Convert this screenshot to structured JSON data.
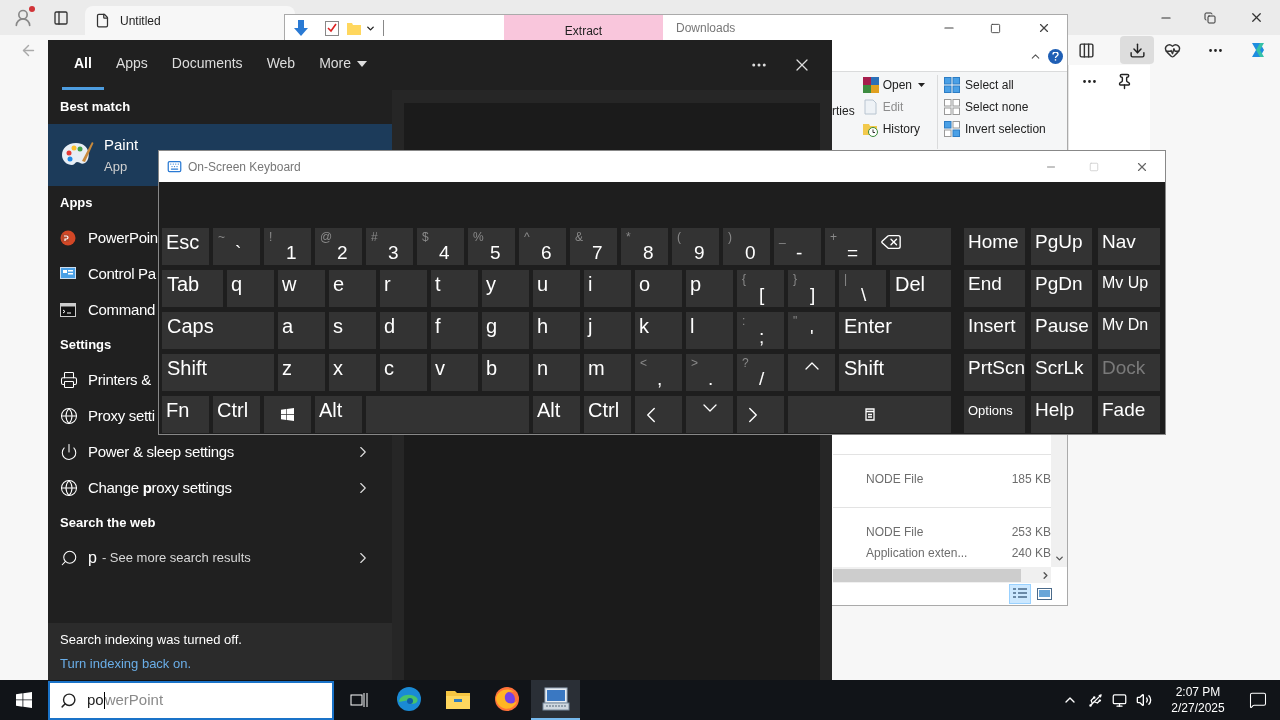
{
  "browser": {
    "tab": {
      "title": "Untitled"
    }
  },
  "explorer": {
    "ribbon_tab": "Extract",
    "title": "Downloads",
    "fragment": "rties",
    "open_group": [
      {
        "label": "Open",
        "kind": "dropdown",
        "disabled": false
      },
      {
        "label": "Edit",
        "kind": "edit",
        "disabled": true
      },
      {
        "label": "History",
        "kind": "history",
        "disabled": false
      }
    ],
    "select_group": [
      {
        "label": "Select all",
        "kind": "all"
      },
      {
        "label": "Select none",
        "kind": "none"
      },
      {
        "label": "Invert selection",
        "kind": "invert"
      }
    ],
    "files": [
      {
        "type": "NODE File",
        "size": "185 KB",
        "group_start": true
      },
      {
        "type": "NODE File",
        "size": "253 KB",
        "group_start": true
      },
      {
        "type": "Application exten...",
        "size": "240 KB",
        "group_start": false
      }
    ],
    "views": [
      {
        "kind": "details",
        "selected": true
      },
      {
        "kind": "tiles",
        "selected": false
      }
    ]
  },
  "search": {
    "tabs": [
      {
        "label": "All",
        "kind": "plain",
        "selected": true
      },
      {
        "label": "Apps",
        "kind": "plain",
        "selected": false
      },
      {
        "label": "Documents",
        "kind": "plain",
        "selected": false
      },
      {
        "label": "Web",
        "kind": "plain",
        "selected": false
      },
      {
        "label": "More",
        "kind": "menu",
        "selected": false
      }
    ],
    "sections": [
      {
        "heading": "Best match",
        "items": [
          {
            "kind": "paint",
            "label": "Paint",
            "subtitle": "App",
            "selected": true
          }
        ]
      },
      {
        "heading": "Apps",
        "items": [
          {
            "kind": "powerpoint",
            "label": "PowerPoin",
            "selected": false
          },
          {
            "kind": "control-panel",
            "label": "Control Pa",
            "selected": false
          },
          {
            "kind": "cmd",
            "label": "Command",
            "selected": false
          }
        ]
      },
      {
        "heading": "Settings",
        "items": [
          {
            "kind": "printer",
            "label": "Printers &",
            "selected": false
          },
          {
            "kind": "globe",
            "label": "Proxy setti",
            "selected": false
          },
          {
            "kind": "power",
            "label": "Power & sleep settings",
            "chevron": true,
            "selected": false
          },
          {
            "kind": "globe",
            "label": "Change **p**roxy settings",
            "chevron": true,
            "selected": false
          }
        ]
      },
      {
        "heading": "Search the web",
        "items": [
          {
            "kind": "web",
            "label": "p",
            "detail": "- See more search results",
            "chevron": true,
            "selected": false
          }
        ]
      }
    ],
    "notice": {
      "text": "Search indexing was turned off.",
      "link": "Turn indexing back on."
    }
  },
  "keyboard": {
    "title": "On-Screen Keyboard",
    "rows": [
      [
        {
          "kind": "label",
          "label": "Esc"
        },
        {
          "kind": "dual",
          "shift": "~",
          "label": "`"
        },
        {
          "kind": "dual",
          "shift": "!",
          "label": "1"
        },
        {
          "kind": "dual",
          "shift": "@",
          "label": "2"
        },
        {
          "kind": "dual",
          "shift": "#",
          "label": "3"
        },
        {
          "kind": "dual",
          "shift": "$",
          "label": "4"
        },
        {
          "kind": "dual",
          "shift": "%",
          "label": "5"
        },
        {
          "kind": "dual",
          "shift": "^",
          "label": "6"
        },
        {
          "kind": "dual",
          "shift": "&",
          "label": "7"
        },
        {
          "kind": "dual",
          "shift": "*",
          "label": "8"
        },
        {
          "kind": "dual",
          "shift": "(",
          "label": "9"
        },
        {
          "kind": "dual",
          "shift": ")",
          "label": "0"
        },
        {
          "kind": "dual",
          "shift": "_",
          "label": "-"
        },
        {
          "kind": "dual",
          "shift": "+",
          "label": "="
        },
        {
          "kind": "backspace"
        }
      ],
      [
        {
          "kind": "wide",
          "label": "Tab"
        },
        {
          "kind": "label",
          "label": "q"
        },
        {
          "kind": "label",
          "label": "w"
        },
        {
          "kind": "label",
          "label": "e"
        },
        {
          "kind": "label",
          "label": "r"
        },
        {
          "kind": "label",
          "label": "t"
        },
        {
          "kind": "label",
          "label": "y"
        },
        {
          "kind": "label",
          "label": "u"
        },
        {
          "kind": "label",
          "label": "i"
        },
        {
          "kind": "label",
          "label": "o"
        },
        {
          "kind": "label",
          "label": "p"
        },
        {
          "kind": "dual",
          "shift": "{",
          "label": "["
        },
        {
          "kind": "dual",
          "shift": "}",
          "label": "]"
        },
        {
          "kind": "dual",
          "shift": "|",
          "label": "\\"
        },
        {
          "kind": "wide",
          "label": "Del"
        }
      ],
      [
        {
          "kind": "wide",
          "label": "Caps"
        },
        {
          "kind": "label",
          "label": "a"
        },
        {
          "kind": "label",
          "label": "s"
        },
        {
          "kind": "label",
          "label": "d"
        },
        {
          "kind": "label",
          "label": "f"
        },
        {
          "kind": "label",
          "label": "g"
        },
        {
          "kind": "label",
          "label": "h"
        },
        {
          "kind": "label",
          "label": "j"
        },
        {
          "kind": "label",
          "label": "k"
        },
        {
          "kind": "label",
          "label": "l"
        },
        {
          "kind": "dual",
          "shift": ":",
          "label": ";"
        },
        {
          "kind": "dual",
          "shift": "\"",
          "label": "'"
        },
        {
          "kind": "wide",
          "label": "Enter"
        }
      ],
      [
        {
          "kind": "wide",
          "label": "Shift"
        },
        {
          "kind": "label",
          "label": "z"
        },
        {
          "kind": "label",
          "label": "x"
        },
        {
          "kind": "label",
          "label": "c"
        },
        {
          "kind": "label",
          "label": "v"
        },
        {
          "kind": "label",
          "label": "b"
        },
        {
          "kind": "label",
          "label": "n"
        },
        {
          "kind": "label",
          "label": "m"
        },
        {
          "kind": "dual",
          "shift": "<",
          "label": ","
        },
        {
          "kind": "dual",
          "shift": ">",
          "label": "."
        },
        {
          "kind": "dual",
          "shift": "?",
          "label": "/"
        },
        {
          "kind": "up"
        },
        {
          "kind": "wide",
          "label": "Shift"
        }
      ],
      [
        {
          "kind": "label",
          "label": "Fn"
        },
        {
          "kind": "label",
          "label": "Ctrl"
        },
        {
          "kind": "windows"
        },
        {
          "kind": "label",
          "label": "Alt"
        },
        {
          "kind": "space"
        },
        {
          "kind": "label",
          "label": "Alt"
        },
        {
          "kind": "label",
          "label": "Ctrl"
        },
        {
          "kind": "left"
        },
        {
          "kind": "down"
        },
        {
          "kind": "right"
        },
        {
          "kind": "menu"
        }
      ]
    ],
    "side_keys": [
      {
        "label": "Home",
        "kind": "label",
        "disabled": false
      },
      {
        "label": "PgUp",
        "kind": "label",
        "disabled": false
      },
      {
        "label": "Nav",
        "kind": "label",
        "disabled": false
      },
      {
        "label": "End",
        "kind": "label",
        "disabled": false
      },
      {
        "label": "PgDn",
        "kind": "label",
        "disabled": false
      },
      {
        "label": "Mv Up",
        "kind": "small",
        "disabled": false
      },
      {
        "label": "Insert",
        "kind": "label",
        "disabled": false
      },
      {
        "label": "Pause",
        "kind": "label",
        "disabled": false
      },
      {
        "label": "Mv Dn",
        "kind": "small",
        "disabled": false
      },
      {
        "label": "PrtScn",
        "kind": "label",
        "disabled": false
      },
      {
        "label": "ScrLk",
        "kind": "label",
        "disabled": false
      },
      {
        "label": "Dock",
        "kind": "label",
        "disabled": true
      },
      {
        "label": "Options",
        "kind": "tiny",
        "disabled": false
      },
      {
        "label": "Help",
        "kind": "label",
        "disabled": false
      },
      {
        "label": "Fade",
        "kind": "label",
        "disabled": false
      }
    ]
  },
  "taskbar": {
    "search": {
      "typed": "po",
      "suggestion": "werPoint"
    },
    "apps": [
      {
        "kind": "edge",
        "active": false
      },
      {
        "kind": "explorer",
        "active": false
      },
      {
        "kind": "firefox",
        "active": false
      },
      {
        "kind": "osk",
        "active": true
      }
    ],
    "time": "2:07 PM",
    "date": "2/27/2025"
  }
}
